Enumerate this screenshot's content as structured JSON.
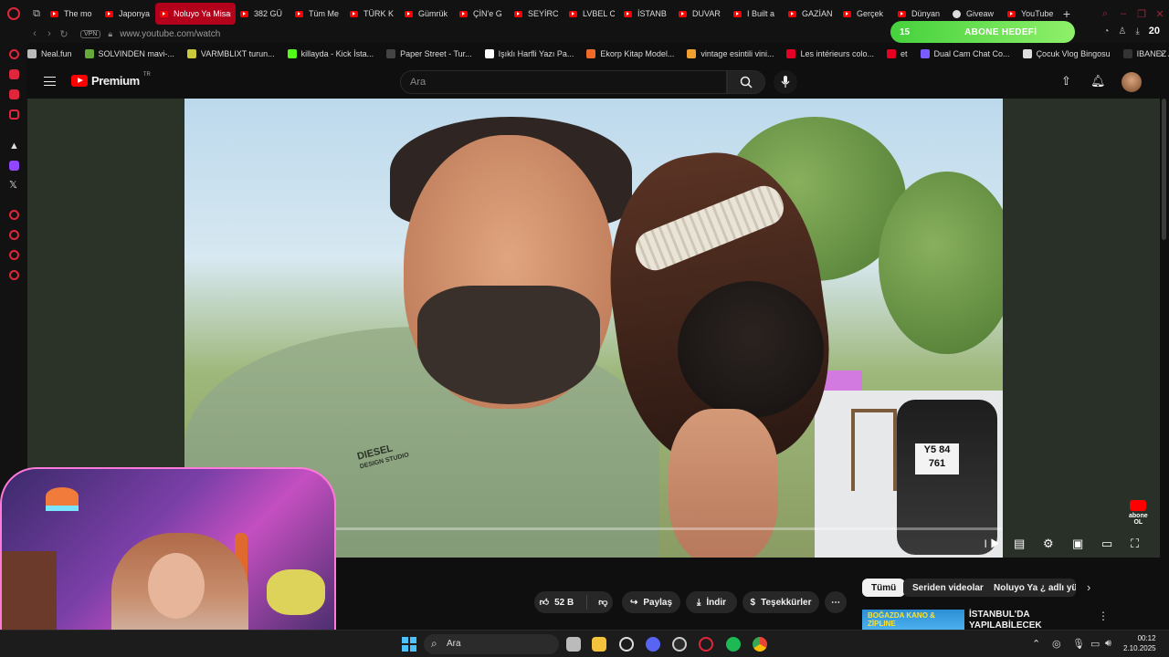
{
  "tabs": [
    {
      "label": "The mo",
      "icon": "youtube-icon"
    },
    {
      "label": "Japonya",
      "icon": "youtube-icon"
    },
    {
      "label": "Noluyo Ya Misar",
      "icon": "youtube-icon",
      "active": true
    },
    {
      "label": "382 GÜ",
      "icon": "youtube-icon"
    },
    {
      "label": "Tüm Me",
      "icon": "youtube-icon"
    },
    {
      "label": "TÜRK K",
      "icon": "youtube-icon"
    },
    {
      "label": "Gümrük",
      "icon": "youtube-icon"
    },
    {
      "label": "ÇİN'e G",
      "icon": "youtube-icon"
    },
    {
      "label": "SEYİRC",
      "icon": "youtube-icon"
    },
    {
      "label": "LVBEL C",
      "icon": "youtube-icon"
    },
    {
      "label": "İSTANB",
      "icon": "youtube-icon"
    },
    {
      "label": "DUVAR",
      "icon": "youtube-icon"
    },
    {
      "label": "I Built a",
      "icon": "youtube-icon"
    },
    {
      "label": "GAZİAN",
      "icon": "youtube-icon"
    },
    {
      "label": "Gerçek",
      "icon": "youtube-icon"
    },
    {
      "label": "Dünyan",
      "icon": "youtube-icon"
    },
    {
      "label": "Giveaw",
      "icon": "globe-icon"
    },
    {
      "label": "YouTube",
      "icon": "youtube-icon"
    }
  ],
  "address": {
    "vpn": "VPN",
    "url": "www.youtube.com/watch"
  },
  "abone": {
    "count": "15",
    "label": "ABONE HEDEFİ"
  },
  "downloads_count": "20",
  "bookmarks": [
    {
      "label": "Neal.fun",
      "color": "#bbbbbb"
    },
    {
      "label": "SOLVINDEN mavi-...",
      "color": "#67a83a"
    },
    {
      "label": "VARMBLIXT turun...",
      "color": "#c9c93a"
    },
    {
      "label": "killayda - Kick İsta...",
      "color": "#53fc18"
    },
    {
      "label": "Paper Street - Tur...",
      "color": "#444444"
    },
    {
      "label": "Işıklı Harfli Yazı Pa...",
      "color": "#ffffff"
    },
    {
      "label": "Ekorp Kitap Model...",
      "color": "#f06a2a"
    },
    {
      "label": "vintage esintili vini...",
      "color": "#f0a030"
    },
    {
      "label": "Les intérieurs colo...",
      "color": "#e60023"
    },
    {
      "label": "et",
      "color": "#e60023"
    },
    {
      "label": "Dual Cam Chat Co...",
      "color": "#7b5cff"
    },
    {
      "label": "Çocuk Vlog Bingosu",
      "color": "#dddddd"
    },
    {
      "label": "IBANEZ AF75G-B...",
      "color": "#333333"
    }
  ],
  "youtube": {
    "logo_text": "Premium",
    "region": "TR",
    "search_placeholder": "Ara"
  },
  "video": {
    "shirt_line1": "DIESEL",
    "shirt_line2": "DESIGN STUDIO",
    "plate": "Y5 84",
    "plate2": "761",
    "progress": 0.02,
    "watermark_line1": "abone",
    "watermark_line2": "OL"
  },
  "actions": {
    "likes": "52 B",
    "share": "Paylaş",
    "download": "İndir",
    "thanks": "Teşekkürler",
    "more": "⋯"
  },
  "chips": [
    {
      "label": "Tümü",
      "selected": true
    },
    {
      "label": "Seriden videolar",
      "selected": false
    },
    {
      "label": "Noluyo Ya ¿ adlı yükle",
      "selected": false
    }
  ],
  "recommendation": {
    "thumb_text": "BOĞAZDA KANO & ZİPLINE",
    "title": "İSTANBUL'DA YAPILABİLECEK AKTİVİTELER 🌊"
  },
  "taskbar": {
    "search": "Ara",
    "time": "00:12",
    "date": "2.10.2025"
  },
  "colors": {
    "accent": "#ff0000",
    "abone_green": "#46d13d",
    "opera_red": "#e0263a"
  }
}
